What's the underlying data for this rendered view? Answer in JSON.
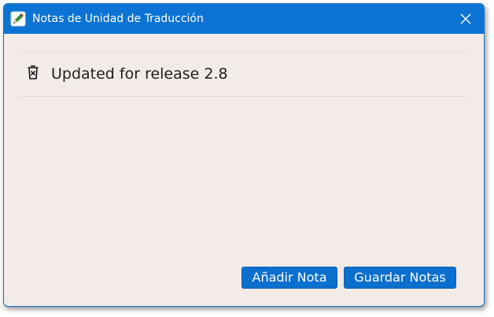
{
  "window": {
    "title": "Notas de Unidad de Traducción"
  },
  "notes": [
    {
      "text": "Updated for release 2.8"
    }
  ],
  "actions": {
    "add_note_label": "Añadir Nota",
    "save_notes_label": "Guardar Notas"
  },
  "icons": {
    "app": "translate-pencil-icon",
    "close": "close-icon",
    "delete": "trash-icon"
  },
  "colors": {
    "titlebar": "#0b73d3",
    "background": "#f2ebe7",
    "button": "#0b6fce"
  }
}
